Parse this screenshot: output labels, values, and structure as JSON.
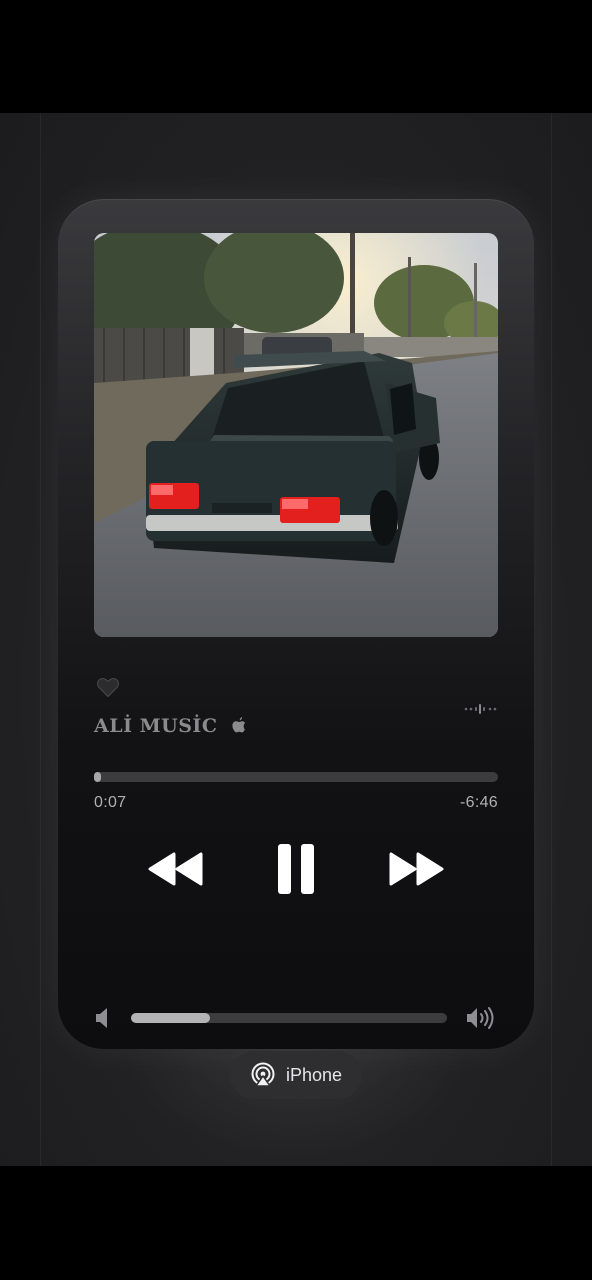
{
  "track": {
    "artist_title": "ALİ MUSİC",
    "liked": true
  },
  "playback": {
    "elapsed": "0:07",
    "remaining": "-6:46",
    "progress_fraction": 0.018,
    "state": "playing"
  },
  "volume": {
    "level_fraction": 0.25
  },
  "output": {
    "device_label": "iPhone"
  },
  "icons": {
    "heart": "heart-icon",
    "apple": "apple-logo-icon",
    "more": "more-dots-icon",
    "rewind": "rewind-icon",
    "pause": "pause-icon",
    "forward": "fast-forward-icon",
    "volume_low": "volume-low-icon",
    "volume_high": "volume-high-icon",
    "airplay": "airplay-icon"
  },
  "colors": {
    "background": "#222224",
    "card": "#121214",
    "track": "#3c3c3f",
    "fill": "#a8a8ab",
    "text": "#b0b0b3"
  }
}
